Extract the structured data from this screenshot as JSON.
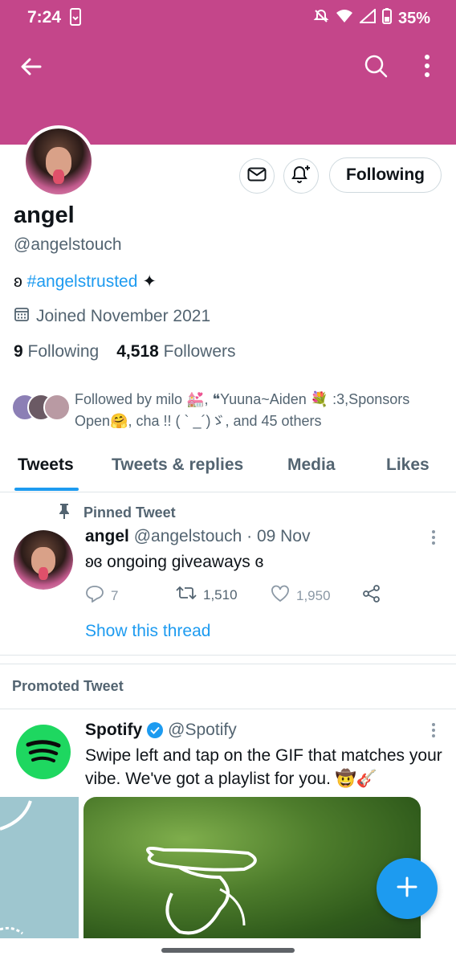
{
  "status_bar": {
    "time": "7:24",
    "battery": "35%"
  },
  "profile": {
    "name": "angel",
    "handle": "@angelstouch",
    "bio_prefix": "ʚ",
    "bio_tag": "#angelstrusted",
    "bio_suffix": "✦",
    "joined": "Joined November 2021",
    "following_count": "9",
    "following_label": "Following",
    "followers_count": "4,518",
    "followers_label": "Followers",
    "follow_button": "Following",
    "followed_by": "Followed by milo 💒, ❝Yuuna~Aiden 💐 :3,Sponsors Open🤗, cha !! ( ` _´)ゞ, and 45 others"
  },
  "tabs": [
    {
      "label": "Tweets",
      "active": true
    },
    {
      "label": "Tweets & replies"
    },
    {
      "label": "Media"
    },
    {
      "label": "Likes"
    }
  ],
  "pinned_tweet": {
    "pinned_label": "Pinned Tweet",
    "author": "angel",
    "handle_date": "@angelstouch · 09 Nov",
    "text": "ʚɞ ongoing giveaways ɞ",
    "replies": "7",
    "retweets": "1,510",
    "likes": "1,950",
    "show_thread": "Show this thread"
  },
  "promoted": {
    "label": "Promoted Tweet",
    "author": "Spotify",
    "handle": "@Spotify",
    "text": "Swipe left and tap on the GIF that matches your vibe. We've got a playlist for you. 🤠🎸"
  },
  "colors": {
    "header": "#c4468a",
    "accent": "#1d9bf0",
    "spotify": "#1ed760"
  },
  "icons": [
    "back-arrow-icon",
    "search-icon",
    "more-vertical-icon",
    "mail-icon",
    "bell-plus-icon",
    "calendar-icon",
    "pin-icon",
    "reply-icon",
    "retweet-icon",
    "like-icon",
    "share-icon",
    "verified-icon",
    "compose-plus-icon"
  ]
}
